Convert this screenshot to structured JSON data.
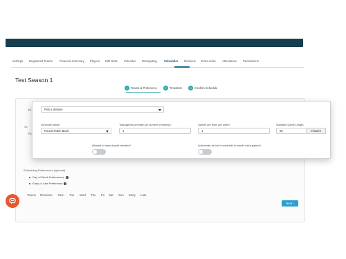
{
  "nav": {
    "tabs": [
      {
        "label": "Settings"
      },
      {
        "label": "Registered Teams"
      },
      {
        "label": "Financial Summary"
      },
      {
        "label": "Players"
      },
      {
        "label": "Edit Slots"
      },
      {
        "label": "Calendar"
      },
      {
        "label": "Retargeting"
      },
      {
        "label": "Scheduler"
      },
      {
        "label": "Divisions"
      },
      {
        "label": "Extra Links"
      },
      {
        "label": "Attendance"
      },
      {
        "label": "Permissions"
      }
    ],
    "active": "Scheduler"
  },
  "page": {
    "title": "Test Season 1"
  },
  "steps": [
    {
      "num": "1",
      "label": "Teams & Preference"
    },
    {
      "num": "2",
      "label": "Timeslots"
    },
    {
      "num": "3",
      "label": "Confirm Schedule"
    }
  ],
  "background_fragments": {
    "p1": "Pi",
    "p2": "Sc",
    "p3": "Ro"
  },
  "modal": {
    "division_select": {
      "value": "Pick a division"
    },
    "schedule_model": {
      "label": "Schedule Model",
      "value": "Round Robin Basic"
    },
    "total_games": {
      "label": "Total games per team (or number of weeks)?",
      "value": "1"
    },
    "games_per_week": {
      "label": "Games per team per week?",
      "value": "1"
    },
    "game_length": {
      "label": "Standard Game Length",
      "value": "60",
      "unit": "minutes"
    },
    "double_headers": {
      "label": "Allowed to have double headers?"
    },
    "extra_weeks": {
      "label": "Add weeks at end of schedule to handle extra games?"
    }
  },
  "preferences": {
    "title": "Scheduling Preferences (optional)",
    "items": [
      {
        "label": "Day of Week Preferences"
      },
      {
        "label": "Early or Late Preference"
      }
    ]
  },
  "subtabs": [
    {
      "label": "Teams"
    },
    {
      "label": "Divisions"
    },
    {
      "label": "Mon"
    },
    {
      "label": "Tue"
    },
    {
      "label": "Wed"
    },
    {
      "label": "Thu"
    },
    {
      "label": "Fri"
    },
    {
      "label": "Sat"
    },
    {
      "label": "Sun"
    },
    {
      "label": "Early"
    },
    {
      "label": "Late"
    }
  ],
  "buttons": {
    "next": "Next ›"
  },
  "colors": {
    "header": "#163e4f",
    "accent": "#2aa7a7",
    "primary_button": "#2a9fd0",
    "chat": "#e8562d"
  },
  "icons": {
    "chat": "chat-bubble-icon",
    "info": "info-icon",
    "dropdown": "chevron-down-icon"
  }
}
